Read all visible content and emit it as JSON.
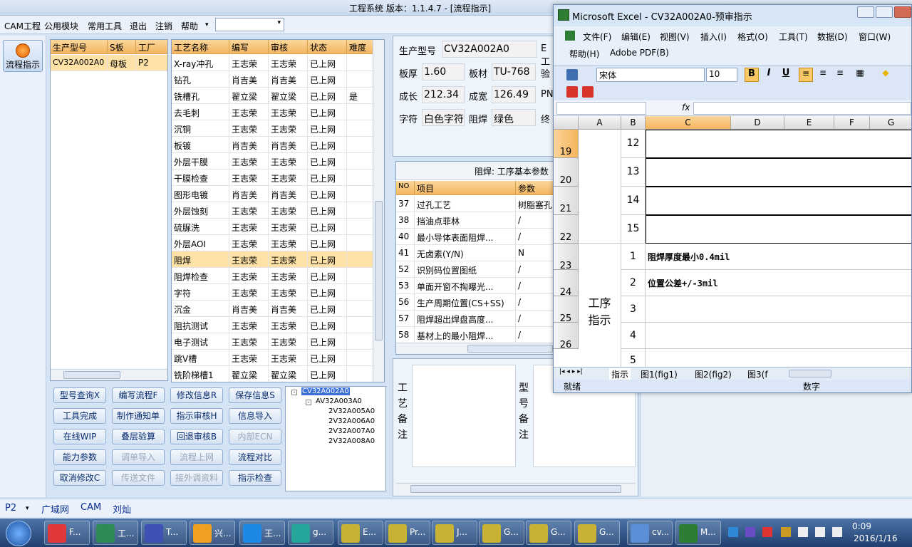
{
  "app": {
    "title": "工程系统  版本：1.1.4.7 - [流程指示]"
  },
  "menu": [
    "CAM工程",
    "公用模块",
    "常用工具",
    "退出",
    "注销",
    "帮助"
  ],
  "menu_help_arrow": "▾",
  "toolbar_combo_value": "",
  "left": {
    "flow_button": "流程指示"
  },
  "model_grid": {
    "headers": [
      "生产型号",
      "S板",
      "工厂"
    ],
    "row": [
      "CV32A002A0",
      "母板",
      "P2"
    ]
  },
  "process_grid": {
    "headers": [
      "工艺名称",
      "编写",
      "审核",
      "状态",
      "难度"
    ],
    "rows": [
      [
        "X-ray冲孔",
        "王志荣",
        "王志荣",
        "已上网",
        ""
      ],
      [
        "钻孔",
        "肖吉美",
        "肖吉美",
        "已上网",
        ""
      ],
      [
        "铣槽孔",
        "翟立梁",
        "翟立梁",
        "已上网",
        "是"
      ],
      [
        "去毛刺",
        "王志荣",
        "王志荣",
        "已上网",
        ""
      ],
      [
        "沉铜",
        "王志荣",
        "王志荣",
        "已上网",
        ""
      ],
      [
        "板镀",
        "肖吉美",
        "肖吉美",
        "已上网",
        ""
      ],
      [
        "外层干膜",
        "王志荣",
        "王志荣",
        "已上网",
        ""
      ],
      [
        "干膜检查",
        "王志荣",
        "王志荣",
        "已上网",
        ""
      ],
      [
        "图形电镀",
        "肖吉美",
        "肖吉美",
        "已上网",
        ""
      ],
      [
        "外层蚀刻",
        "王志荣",
        "王志荣",
        "已上网",
        ""
      ],
      [
        "硫脲洗",
        "王志荣",
        "王志荣",
        "已上网",
        ""
      ],
      [
        "外层AOI",
        "王志荣",
        "王志荣",
        "已上网",
        ""
      ],
      [
        "阻焊",
        "王志荣",
        "王志荣",
        "已上网",
        ""
      ],
      [
        "阻焊检查",
        "王志荣",
        "王志荣",
        "已上网",
        ""
      ],
      [
        "字符",
        "王志荣",
        "王志荣",
        "已上网",
        ""
      ],
      [
        "沉金",
        "肖吉美",
        "肖吉美",
        "已上网",
        ""
      ],
      [
        "阻抗测试",
        "王志荣",
        "王志荣",
        "已上网",
        ""
      ],
      [
        "电子测试",
        "王志荣",
        "王志荣",
        "已上网",
        ""
      ],
      [
        "跳V槽",
        "王志荣",
        "王志荣",
        "已上网",
        ""
      ],
      [
        "铣阶梯槽1",
        "翟立梁",
        "翟立梁",
        "已上网",
        ""
      ]
    ],
    "selected_index": 12
  },
  "buttons": [
    [
      {
        "label": "型号查询X",
        "enabled": true
      },
      {
        "label": "编写流程F",
        "enabled": true
      },
      {
        "label": "修改信息R",
        "enabled": true
      },
      {
        "label": "保存信息S",
        "enabled": true
      }
    ],
    [
      {
        "label": "工具完成",
        "enabled": true
      },
      {
        "label": "制作通知单",
        "enabled": true
      },
      {
        "label": "指示审核H",
        "enabled": true
      },
      {
        "label": "信息导入",
        "enabled": true
      }
    ],
    [
      {
        "label": "在线WIP",
        "enabled": true
      },
      {
        "label": "叠层验算",
        "enabled": true
      },
      {
        "label": "回退审核B",
        "enabled": true
      },
      {
        "label": "内部ECN",
        "enabled": false
      }
    ],
    [
      {
        "label": "能力参数",
        "enabled": true
      },
      {
        "label": "调单导入",
        "enabled": false
      },
      {
        "label": "流程上网",
        "enabled": false
      },
      {
        "label": "流程对比",
        "enabled": true
      }
    ],
    [
      {
        "label": "取消修改C",
        "enabled": true
      },
      {
        "label": "传送文件",
        "enabled": false
      },
      {
        "label": "接外调资料",
        "enabled": false
      },
      {
        "label": "指示检查",
        "enabled": true
      }
    ]
  ],
  "tree": {
    "root": "CV32A002A0",
    "child": "AV32A003A0",
    "leaves": [
      "2V32A005A0",
      "2V32A006A0",
      "2V32A007A0",
      "2V32A008A0"
    ]
  },
  "info": {
    "model_label": "生产型号",
    "model_value": "CV32A002A0",
    "e_label": "E工",
    "thick_label": "板厚",
    "thick_value": "1.60",
    "material_label": "板材",
    "material_value": "TU-768",
    "check_label": "验",
    "len_label": "成长",
    "len_value": "212.34",
    "wid_label": "成宽",
    "wid_value": "126.49",
    "pn_label": "PN",
    "char_label": "字符",
    "char_value": "白色字符",
    "mask_label": "阻焊",
    "mask_value": "绿色",
    "end_label": "终"
  },
  "param_grid": {
    "title": "阻焊: 工序基本参数",
    "headers": [
      "NO",
      "项目",
      "参数"
    ],
    "rows": [
      [
        "37",
        "过孔工艺",
        "树脂塞孔"
      ],
      [
        "38",
        "挡油点菲林",
        "/"
      ],
      [
        "40",
        "最小导体表面阻焊...",
        "/"
      ],
      [
        "41",
        "无卤素(Y/N)",
        "N"
      ],
      [
        "52",
        "识别码位置图纸",
        "/"
      ],
      [
        "53",
        "单面开窗不掏曝光...",
        "/"
      ],
      [
        "56",
        "生产周期位置(CS+SS)",
        "/"
      ],
      [
        "57",
        "阻焊超出焊盘高度...",
        "/"
      ],
      [
        "58",
        "基材上的最小阻焊...",
        "/"
      ]
    ]
  },
  "notes": {
    "process_note_label": "工艺备注",
    "model_note_label": "型号备注"
  },
  "status": {
    "factory": "P2",
    "items": [
      "广域网",
      "CAM",
      "刘灿"
    ]
  },
  "excel": {
    "title": "Microsoft Excel - CV32A002A0-预审指示",
    "menu": [
      "文件(F)",
      "编辑(E)",
      "视图(V)",
      "插入(I)",
      "格式(O)",
      "工具(T)",
      "数据(D)",
      "窗口(W)"
    ],
    "menu2": [
      "帮助(H)",
      "Adobe PDF(B)"
    ],
    "font": "宋体",
    "size": "10",
    "fx": "fx",
    "columns": [
      "A",
      "B",
      "C",
      "D",
      "E",
      "F",
      "G"
    ],
    "rows": [
      {
        "n": "19",
        "b": "12",
        "c": ""
      },
      {
        "n": "20",
        "b": "13",
        "c": ""
      },
      {
        "n": "21",
        "b": "14",
        "c": ""
      },
      {
        "n": "22",
        "b": "15",
        "c": ""
      },
      {
        "n": "23",
        "b": "1",
        "c": "阻焊厚度最小0.4mil"
      },
      {
        "n": "24",
        "b": "2",
        "c": "位置公差+/-3mil"
      },
      {
        "n": "25",
        "b": "3",
        "c": ""
      },
      {
        "n": "26",
        "b": "4",
        "c": ""
      }
    ],
    "merged_a": "工序指示",
    "partial_b": "5",
    "sheet_tabs": [
      "指示",
      "图1(fig1)",
      "图2(fig2)",
      "图3(f"
    ],
    "status_left": "就绪",
    "status_right": "数字"
  },
  "taskbar": {
    "items": [
      "F...",
      "工...",
      "T...",
      "兴...",
      "王...",
      "g...",
      "E...",
      "Pr...",
      "J...",
      "G...",
      "G...",
      "G...",
      "cv...",
      "M..."
    ],
    "time": "0:09",
    "date": "2016/1/16"
  }
}
